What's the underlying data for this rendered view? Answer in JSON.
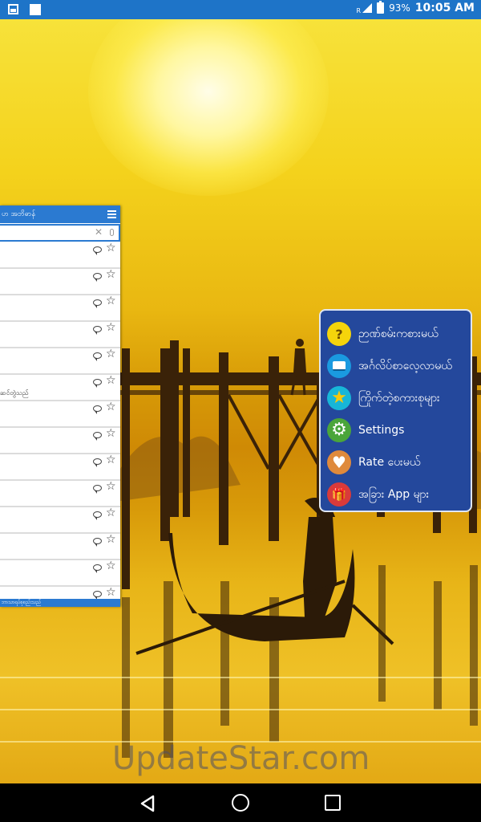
{
  "status_bar": {
    "signal_label": "R",
    "battery": "93%",
    "time": "10:05 AM"
  },
  "wallpaper": {
    "watermark": "UpdateStar.com"
  },
  "widget": {
    "header_title": "ဟ အဘိဓာန်",
    "row_text": "ဆင်တွဲသည်",
    "footer_text": "ဘာသာရပ်စုစည်းသည်",
    "row_count": 14,
    "text_row_index": 5
  },
  "menu": {
    "items": [
      {
        "label": "ဉာဏ်စမ်းကစားမယ်",
        "icon": "quiz-face-icon",
        "color": "#f5d40b"
      },
      {
        "label": "အင်္ဂလိပ်စာလေ့လာမယ်",
        "icon": "book-icon",
        "color": "#1a9ae0"
      },
      {
        "label": "ကြိုက်တဲ့စကားစုများ",
        "icon": "star-icon",
        "color": "#17b6d8"
      },
      {
        "label": "Settings",
        "icon": "gear-icon",
        "color": "#4aa53a"
      },
      {
        "label": "Rate ပေးမယ်",
        "icon": "heart-icon",
        "color": "#df8a3c"
      },
      {
        "label": "အခြား App များ",
        "icon": "gift-icon",
        "color": "#d93a3a"
      }
    ]
  },
  "colors": {
    "status_bar": "#1e74c8",
    "menu_background": "#24489c",
    "widget_accent": "#2b7ad1"
  }
}
